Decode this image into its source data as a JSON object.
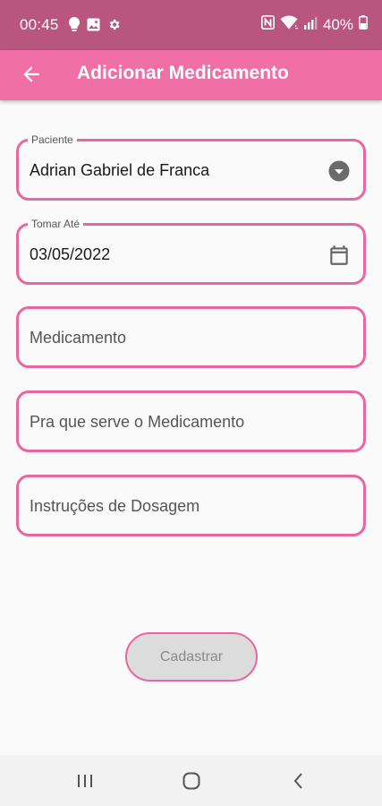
{
  "status_bar": {
    "time": "00:45",
    "battery": "40%"
  },
  "app_bar": {
    "title": "Adicionar Medicamento"
  },
  "form": {
    "patient": {
      "label": "Paciente",
      "value": "Adrian Gabriel de Franca"
    },
    "take_until": {
      "label": "Tomar Até",
      "value": "03/05/2022"
    },
    "medication": {
      "placeholder": "Medicamento"
    },
    "purpose": {
      "placeholder": "Pra que serve o Medicamento"
    },
    "dosage": {
      "placeholder": "Instruções de Dosagem"
    },
    "submit_label": "Cadastrar"
  },
  "colors": {
    "status_bar": "#b8567f",
    "app_bar": "#f06fa6",
    "field_border": "#e9679e",
    "button_bg": "#dcdcdc"
  },
  "icons": {
    "back": "arrow-left-icon",
    "dropdown": "dropdown-circle-icon",
    "calendar": "calendar-icon",
    "nav_recents": "recents-icon",
    "nav_home": "home-icon",
    "nav_back": "back-chevron-icon"
  }
}
